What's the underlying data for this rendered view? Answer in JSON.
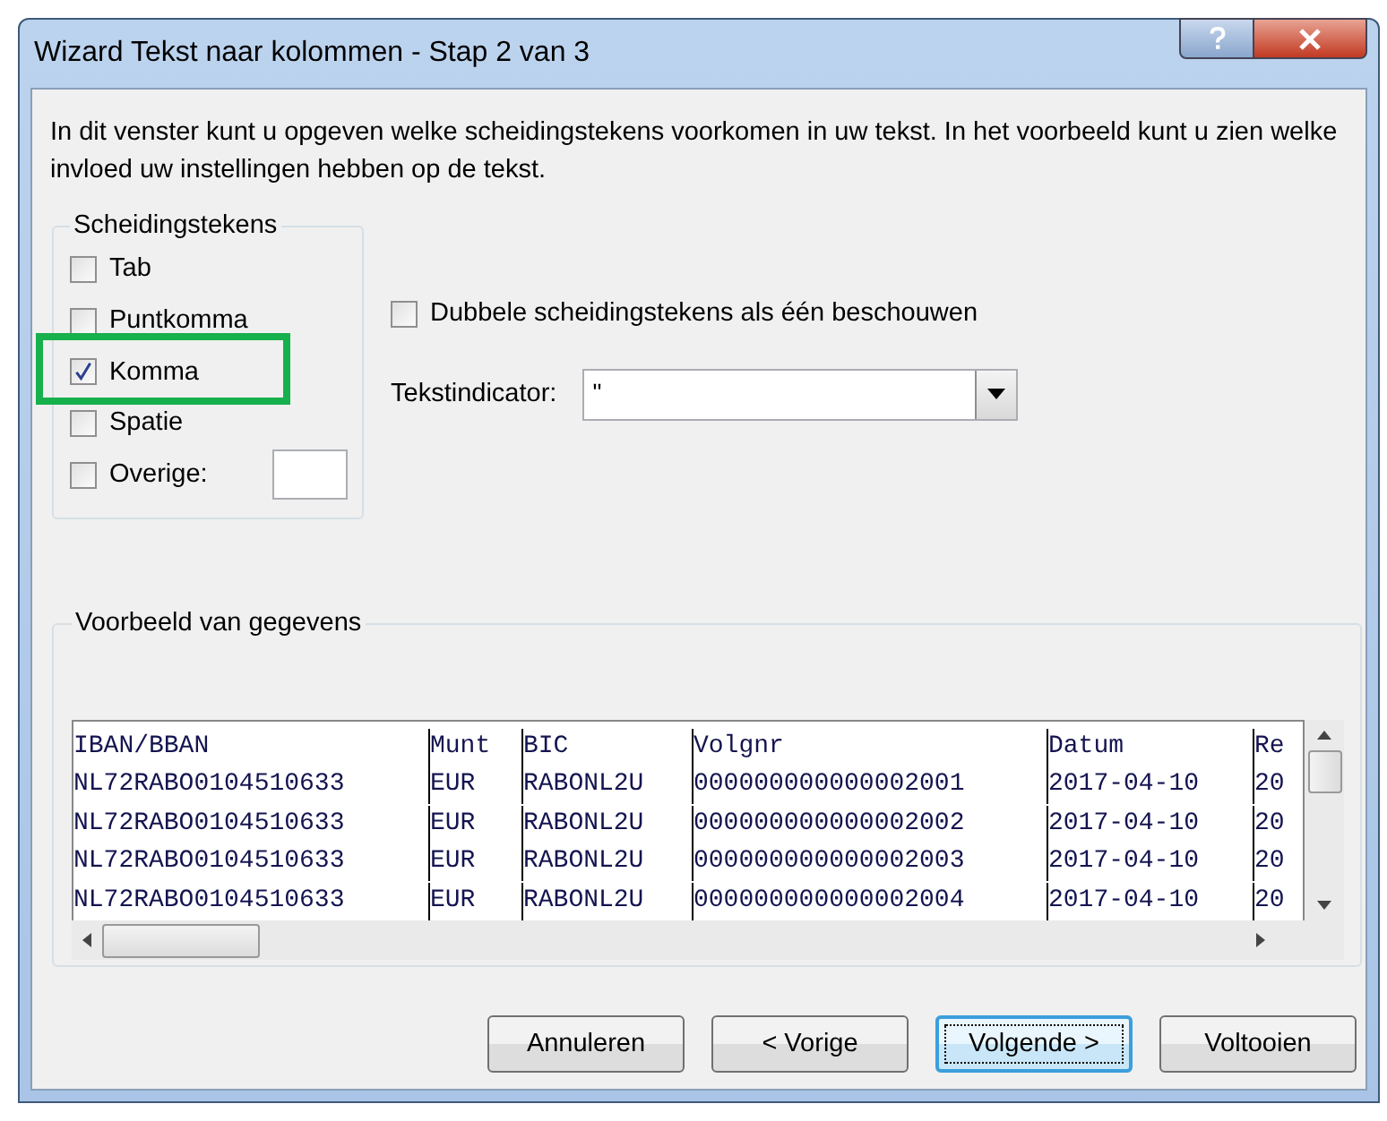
{
  "window": {
    "title": "Wizard Tekst naar kolommen - Stap 2 van 3"
  },
  "description": "In dit venster kunt u opgeven welke scheidingstekens voorkomen in uw tekst. In het voorbeeld kunt u zien welke invloed uw instellingen hebben op de tekst.",
  "delimiters": {
    "title": "Scheidingstekens",
    "options": [
      {
        "label": "Tab",
        "checked": false,
        "highlighted": false,
        "kind": "plain"
      },
      {
        "label": "Puntkomma",
        "checked": false,
        "highlighted": false,
        "kind": "plain"
      },
      {
        "label": "Komma",
        "checked": true,
        "highlighted": true,
        "kind": "plain"
      },
      {
        "label": "Spatie",
        "checked": false,
        "highlighted": false,
        "kind": "plain"
      },
      {
        "label": "Overige:",
        "checked": false,
        "highlighted": false,
        "kind": "other"
      }
    ]
  },
  "consecutive": {
    "label": "Dubbele scheidingstekens als één beschouwen",
    "checked": false
  },
  "text_qualifier": {
    "label": "Tekstindicator:",
    "value": "\""
  },
  "preview": {
    "title": "Voorbeeld van gegevens",
    "rows": [
      [
        "IBAN/BBAN",
        "Munt",
        "BIC",
        "Volgnr",
        "Datum",
        "Re"
      ],
      [
        "NL72RABO0104510633",
        "EUR",
        "RABONL2U",
        "000000000000002001",
        "2017-04-10",
        "20"
      ],
      [
        "NL72RABO0104510633",
        "EUR",
        "RABONL2U",
        "000000000000002002",
        "2017-04-10",
        "20"
      ],
      [
        "NL72RABO0104510633",
        "EUR",
        "RABONL2U",
        "000000000000002003",
        "2017-04-10",
        "20"
      ],
      [
        "NL72RABO0104510633",
        "EUR",
        "RABONL2U",
        "000000000000002004",
        "2017-04-10",
        "20"
      ]
    ]
  },
  "buttons": [
    {
      "label": "Annuleren",
      "default": false
    },
    {
      "label": "< Vorige",
      "default": false
    },
    {
      "label": "Volgende >",
      "default": true
    },
    {
      "label": "Voltooien",
      "default": false
    }
  ]
}
